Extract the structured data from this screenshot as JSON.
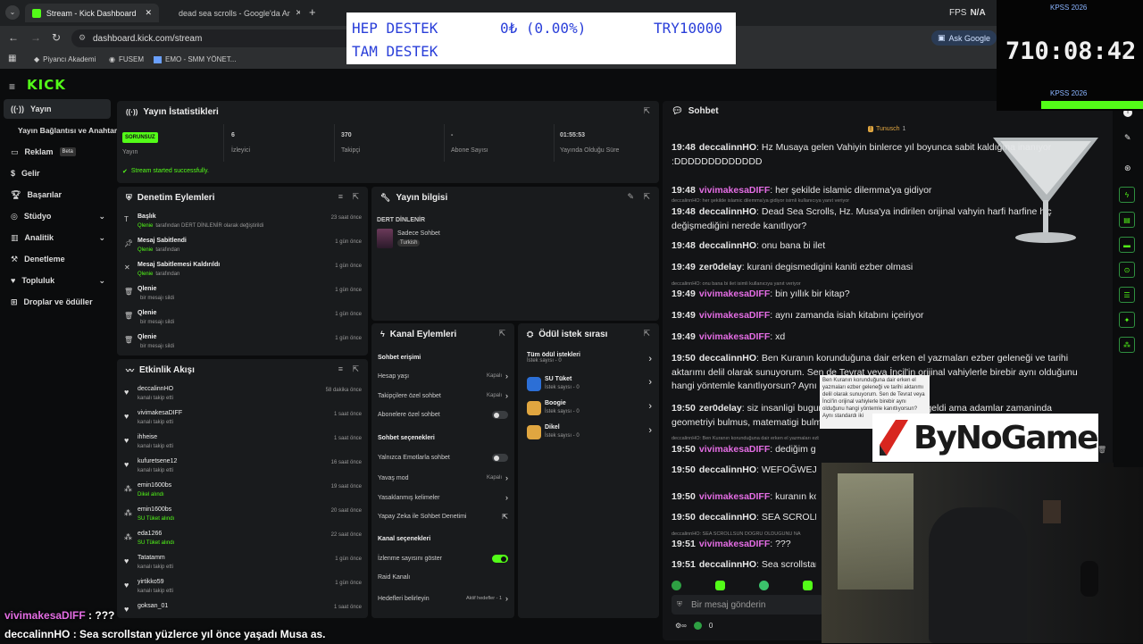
{
  "browser": {
    "tabs": [
      {
        "title": "Stream - Kick Dashboard"
      },
      {
        "title": "dead sea scrolls - Google'da Ar"
      }
    ],
    "url": "dashboard.kick.com/stream",
    "ask_google": "Ask Google",
    "bookmarks": [
      "Piyancı Akademi",
      "FUSEM",
      "EMO - SMM YÖNET..."
    ]
  },
  "overlay": {
    "banner_line1_left": "HEP DESTEK",
    "banner_line1_mid": "0₺ (0.00%)",
    "banner_line1_right": "TRY10000",
    "banner_line2": "TAM DESTEK",
    "fps_label": "FPS",
    "fps_value": "N/A",
    "kpss_label": "KPSS 2026",
    "countdown": "710:08:42",
    "sponsor": "ByNoGame",
    "bottom_line1_user": "vivimakesaDIFF",
    "bottom_line1_text": " : ???",
    "bottom_line2_user": "deccalinnHO",
    "bottom_line2_text": " : Sea scrollstan yüzlerce yıl önce yaşadı Musa as."
  },
  "sidebar": {
    "items": [
      "Yayın",
      "Yayın Bağlantısı ve Anahtarı",
      "Reklam",
      "Gelir",
      "Başarılar",
      "Stüdyo",
      "Analitik",
      "Denetleme",
      "Topluluk",
      "Droplar ve ödüller"
    ],
    "beta": "Beta"
  },
  "stats": {
    "title": "Yayın İstatistikleri",
    "status_badge": "SORUNSUZ",
    "status_label": "Yayın",
    "viewers": "6",
    "viewers_label": "İzleyici",
    "followers": "370",
    "followers_label": "Takipçi",
    "subs": "-",
    "subs_label": "Abone Sayısı",
    "uptime": "01:55:53",
    "uptime_label": "Yayında Olduğu Süre",
    "success": "Stream started successfully."
  },
  "mod": {
    "title": "Denetim Eylemleri",
    "rows": [
      {
        "t": "Başlık",
        "u": "Qlenie",
        "d": "tarafından DERT DİNLENİR olarak değiştirildi",
        "time": "23 saat önce"
      },
      {
        "t": "Mesaj Sabitlendi",
        "u": "Qlenie",
        "d": "tarafından",
        "time": "1 gün önce"
      },
      {
        "t": "Mesaj Sabitlemesi Kaldırıldı",
        "u": "Qlenie",
        "d": "tarafından",
        "time": "1 gün önce"
      },
      {
        "t": "Qlenie",
        "u": "",
        "d": "bir mesajı sildi",
        "time": "1 gün önce"
      },
      {
        "t": "Qlenie",
        "u": "",
        "d": "bir mesajı sildi",
        "time": "1 gün önce"
      },
      {
        "t": "Qlenie",
        "u": "",
        "d": "bir mesajı sildi",
        "time": "1 gün önce"
      }
    ]
  },
  "info": {
    "title": "Yayın bilgisi",
    "stream_title": "DERT DİNLENİR",
    "category": "Sadece Sohbet",
    "lang": "Turkish"
  },
  "activity": {
    "title": "Etkinlik Akışı",
    "rows": [
      {
        "u": "deccalinnHO",
        "d": "kanalı takip etti",
        "time": "58 dakika önce"
      },
      {
        "u": "vivimakesaDIFF",
        "d": "kanalı takip etti",
        "time": "1 saat önce"
      },
      {
        "u": "ihheise",
        "d": "kanalı takip etti",
        "time": "1 saat önce"
      },
      {
        "u": "kufuretsene12",
        "d": "kanalı takip etti",
        "time": "16 saat önce"
      },
      {
        "u": "emin1600bs",
        "d": "Dikel alındı",
        "time": "19 saat önce"
      },
      {
        "u": "emin1600bs",
        "d": "SU Tüket alındı",
        "time": "20 saat önce"
      },
      {
        "u": "eda1266",
        "d": "SU Tüket alındı",
        "time": "22 saat önce"
      },
      {
        "u": "Tatatamm",
        "d": "kanalı takip etti",
        "time": "1 gün önce"
      },
      {
        "u": "yirtikko59",
        "d": "kanalı takip etti",
        "time": "1 gün önce"
      },
      {
        "u": "goksan_01",
        "d": "",
        "time": "1 saat önce"
      }
    ]
  },
  "channel": {
    "title": "Kanal Eylemleri",
    "sec1": "Sohbet erişimi",
    "acc_age": "Hesap yaşı",
    "acc_age_v": "Kapalı",
    "fol_only": "Takipçilere özel sohbet",
    "fol_only_v": "Kapalı",
    "sub_only": "Abonelere özel sohbet",
    "sec2": "Sohbet seçenekleri",
    "emote": "Yalnızca Emotlarla sohbet",
    "slow": "Yavaş mod",
    "slow_v": "Kapalı",
    "banned": "Yasaklanmış kelimeler",
    "ai": "Yapay Zeka ile Sohbet Denetimi",
    "sec3": "Kanal seçenekleri",
    "viewcount": "İzlenme sayısını göster",
    "raid": "Raid Kanalı",
    "goals": "Hedefleri belirleyin",
    "goals_v": "Aktif hedefler - 1"
  },
  "rewards": {
    "title": "Ödül istek sırası",
    "all": "Tüm ödül istekleri",
    "all_sub": "İstek sayısı - 0",
    "items": [
      {
        "name": "SU Tüket",
        "sub": "İstek sayısı - 0"
      },
      {
        "name": "Boogie",
        "sub": "İstek sayısı - 0"
      },
      {
        "name": "Dikel",
        "sub": "İstek sayısı - 0"
      }
    ]
  },
  "chat": {
    "title": "Sohbet",
    "pinned_user": "Tunusch",
    "pinned_count": "1",
    "input_placeholder": "Bir mesaj gönderin",
    "footer_count": "0",
    "lines": [
      {
        "time": "19:48",
        "user": "deccalinnHO",
        "c": "u1",
        "text": ": Hz Musaya gelen Vahiyin binlerce yıl boyunca sabit kaldığına inanıyor :DDDDDDDDDDDDD"
      },
      {
        "time": "19:48",
        "user": "vivimakesaDIFF",
        "c": "u2",
        "text": ": her şekilde islamic dilemma'ya gidiyor"
      },
      {
        "time": "19:48",
        "user": "deccalinnHO",
        "c": "u1",
        "text": ": Dead Sea Scrolls, Hz. Musa'ya indirilen orijinal vahyin harfi harfine hiç değişmediğini nerede kanıtlıyor?"
      },
      {
        "time": "19:48",
        "user": "deccalinnHO",
        "c": "u1",
        "text": ": onu bana bi ilet"
      },
      {
        "time": "19:49",
        "user": "zer0delay",
        "c": "u1",
        "text": ": kurani degismedigini kaniti ezber olmasi"
      },
      {
        "time": "19:49",
        "user": "vivimakesaDIFF",
        "c": "u2",
        "text": ": bin yıllık bir kitap?"
      },
      {
        "time": "19:49",
        "user": "vivimakesaDIFF",
        "c": "u2",
        "text": ": aynı zamanda isiah kitabını içeiriyor"
      },
      {
        "time": "19:49",
        "user": "vivimakesaDIFF",
        "c": "u2",
        "text": ": xd"
      },
      {
        "time": "19:50",
        "user": "deccalinnHO",
        "c": "u1",
        "text": ": Ben Kuranın korunduğuna dair erken el yazmaları ezber geleneği ve tarihi aktarımı delil olarak sunuyorum. Sen de Tevrat veya İncil'in orijinal vahiylerle birebir aynı olduğunu hangi yöntemle kanıtlıyorsun? Aynı standardı"
      },
      {
        "time": "19:50",
        "user": "zer0delay",
        "c": "u1",
        "text": ": siz insanligi bugune kadar ezberleyerek mi geldi ama adamlar zamaninda geometriyi bulmus, matematigi bulmus yildizlarin"
      },
      {
        "time": "19:50",
        "user": "vivimakesaDIFF",
        "c": "u2",
        "text": ": dediğim gibi hocam dead"
      },
      {
        "time": "19:50",
        "user": "deccalinnHO",
        "c": "u1",
        "text": ": WEFOĞWEJGW"
      },
      {
        "time": "19:50",
        "user": "vivimakesaDIFF",
        "c": "u2",
        "text": ": kuranın koru"
      },
      {
        "time": "19:50",
        "user": "deccalinnHO",
        "c": "u1",
        "text": ": SEA SCROLLSU"
      },
      {
        "time": "19:51",
        "user": "vivimakesaDIFF",
        "c": "u2",
        "text": ": ???"
      },
      {
        "time": "19:51",
        "user": "deccalinnHO",
        "c": "u1",
        "text": ": Sea scrollstan y"
      }
    ],
    "sys": [
      "deccalinnHO: her şekilde islamic dilemma'ya gidiyor isimli kullanıcıya yanıt veriyor",
      "deccalinnHO: onu bana bi ilet isimli kullanıcıya yanıt veriyor",
      "deccalinnHO: Ben Kuranın korunduğuna dair erken el yazmaları ezber gelene",
      "deccalinnHO: SEA SCROLLSUN DOGRU OLDUGUNU NA"
    ],
    "tooltip": "Ben Kuranın korunduğuna dair erken el yazmaları ezber geleneği ve tarihi aktarımı delil olarak sunuyorum. Sen de Tevrat veya İncil'in orijinal vahiylerle birebir aynı olduğunu hangi yöntemle kanıtlıyorsun? Aynı standardı iki"
  }
}
